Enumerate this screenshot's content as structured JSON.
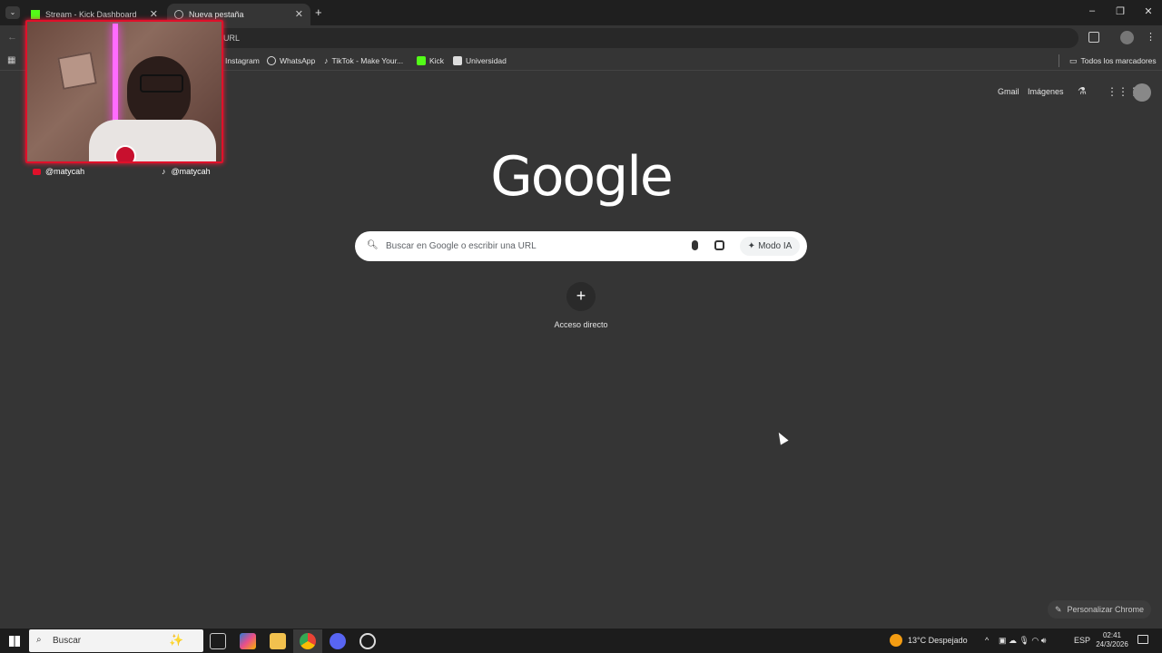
{
  "tabs": [
    {
      "title": "Stream - Kick Dashboard",
      "active": false
    },
    {
      "title": "Nueva pestaña",
      "active": true
    }
  ],
  "omnibox": {
    "text": "URL"
  },
  "bookmarks": [
    {
      "label": "Instagram",
      "icon": "instagram-icon"
    },
    {
      "label": "WhatsApp",
      "icon": "whatsapp-icon"
    },
    {
      "label": "TikTok - Make Your...",
      "icon": "tiktok-icon"
    },
    {
      "label": "Kick",
      "icon": "kick-icon"
    },
    {
      "label": "Universidad",
      "icon": "folder-icon"
    }
  ],
  "all_bookmarks": "Todos los marcadores",
  "camera": {
    "youtube_handle": "@matycah",
    "tiktok_handle": "@matycah"
  },
  "ntp": {
    "logo": "Google",
    "search_placeholder": "Buscar en Google o escribir una URL",
    "ai_mode": "Modo IA",
    "shortcut_label": "Acceso directo",
    "gmail": "Gmail",
    "images": "Imágenes",
    "customize": "Personalizar Chrome"
  },
  "taskbar": {
    "search": "Buscar",
    "weather": "13°C  Despejado",
    "lang": "ESP",
    "time": "02:41",
    "date": "24/3/2026"
  },
  "colors": {
    "kick_green": "#53fc18",
    "accent_red": "#e0102a",
    "chrome_dark": "#353535"
  }
}
